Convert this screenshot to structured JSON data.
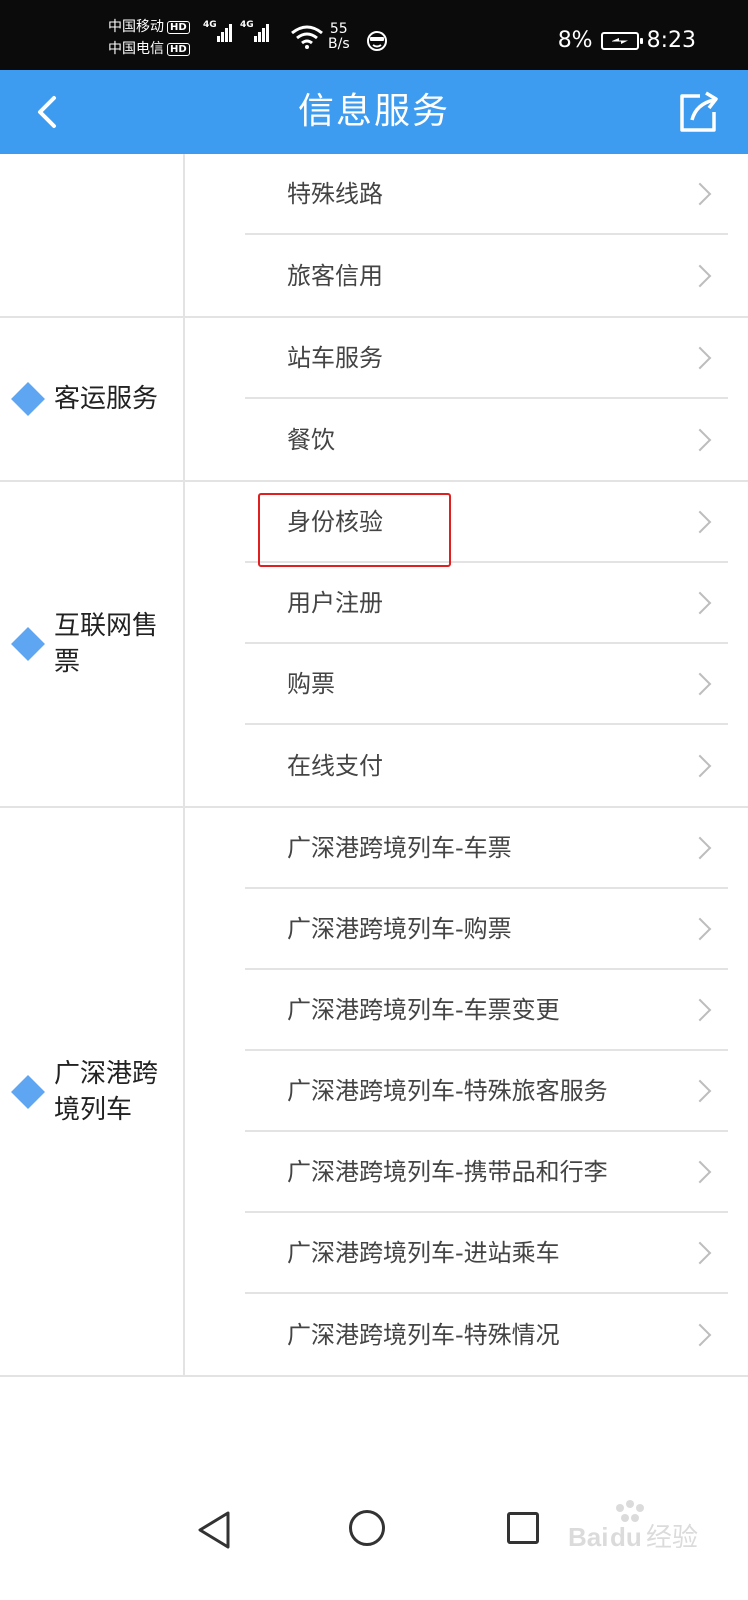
{
  "status_bar": {
    "carrier1": "中国移动",
    "carrier2": "中国电信",
    "hd": "HD",
    "network1": "4G",
    "network2": "4G",
    "speed_value": "55",
    "speed_unit": "B/s",
    "battery_percent": "8%",
    "time": "8:23"
  },
  "header": {
    "title": "信息服务",
    "back_icon": "chevron-left-icon",
    "share_icon": "share-icon",
    "background": "#3d9cf0"
  },
  "groups": [
    {
      "category": "",
      "items": [
        "特殊线路",
        "旅客信用"
      ]
    },
    {
      "category": "客运服务",
      "items": [
        "站车服务",
        "餐饮"
      ]
    },
    {
      "category": "互联网售票",
      "items": [
        "身份核验",
        "用户注册",
        "购票",
        "在线支付"
      ]
    },
    {
      "category": "广深港跨境列车",
      "items": [
        "广深港跨境列车-车票",
        "广深港跨境列车-购票",
        "广深港跨境列车-车票变更",
        "广深港跨境列车-特殊旅客服务",
        "广深港跨境列车-携带品和行李",
        "广深港跨境列车-进站乘车",
        "广深港跨境列车-特殊情况"
      ]
    }
  ],
  "highlighted_item": "身份核验",
  "highlight_color": "#e02020",
  "watermark": "Baidu经验"
}
